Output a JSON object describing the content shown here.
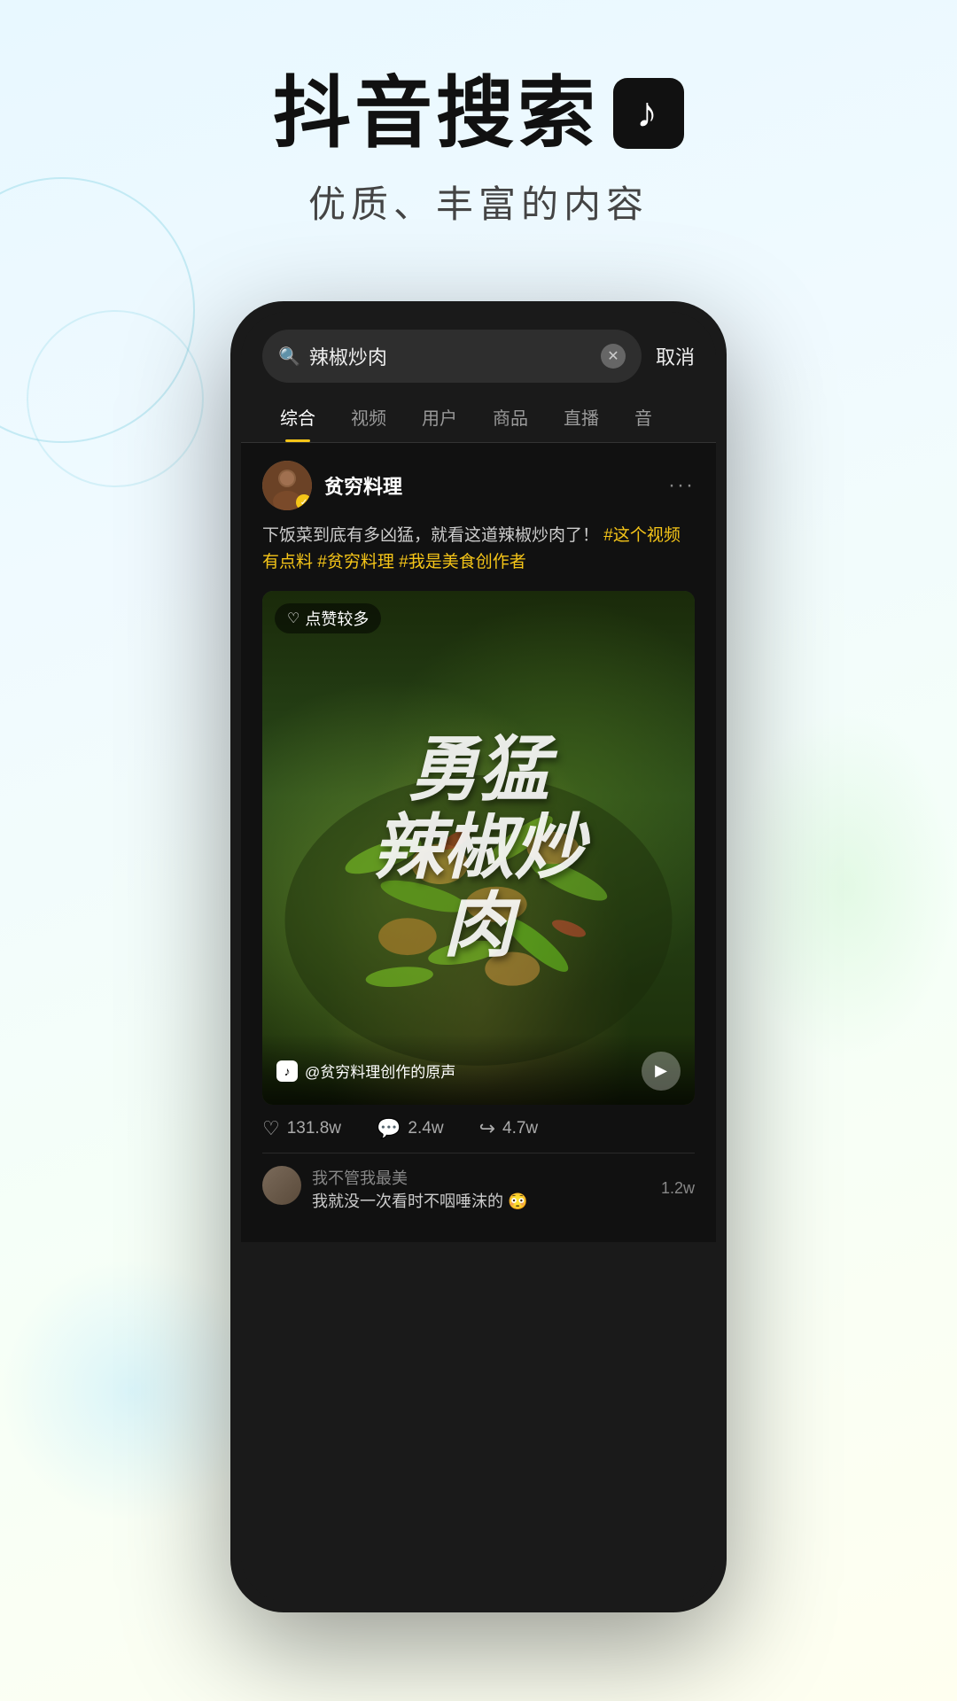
{
  "background": {
    "gradient_start": "#e8f8ff",
    "gradient_end": "#fffff0"
  },
  "header": {
    "title": "抖音搜索",
    "tiktok_symbol": "♪",
    "subtitle": "优质、丰富的内容"
  },
  "phone": {
    "search_bar": {
      "query": "辣椒炒肉",
      "placeholder": "辣椒炒肉",
      "cancel_label": "取消"
    },
    "tabs": [
      {
        "label": "综合",
        "active": true
      },
      {
        "label": "视频",
        "active": false
      },
      {
        "label": "用户",
        "active": false
      },
      {
        "label": "商品",
        "active": false
      },
      {
        "label": "直播",
        "active": false
      },
      {
        "label": "音",
        "active": false
      }
    ],
    "post": {
      "username": "贫穷料理",
      "verified": true,
      "description": "下饭菜到底有多凶猛，就看这道辣椒炒肉了！",
      "hashtags": [
        "#这个视频有点料",
        "#贫穷料理",
        "#我是美食创作者"
      ],
      "video": {
        "badge_text": "点赞较多",
        "overlay_text": "勇猛辣椒炒肉",
        "music_info": "@贫穷料理创作的原声"
      },
      "stats": {
        "likes": "131.8w",
        "comments": "2.4w",
        "shares": "4.7w"
      },
      "comments": [
        {
          "username": "我不管我最美",
          "text": "我就没一次看时不咽唾沫的 😳",
          "count": "1.2w"
        }
      ]
    }
  }
}
